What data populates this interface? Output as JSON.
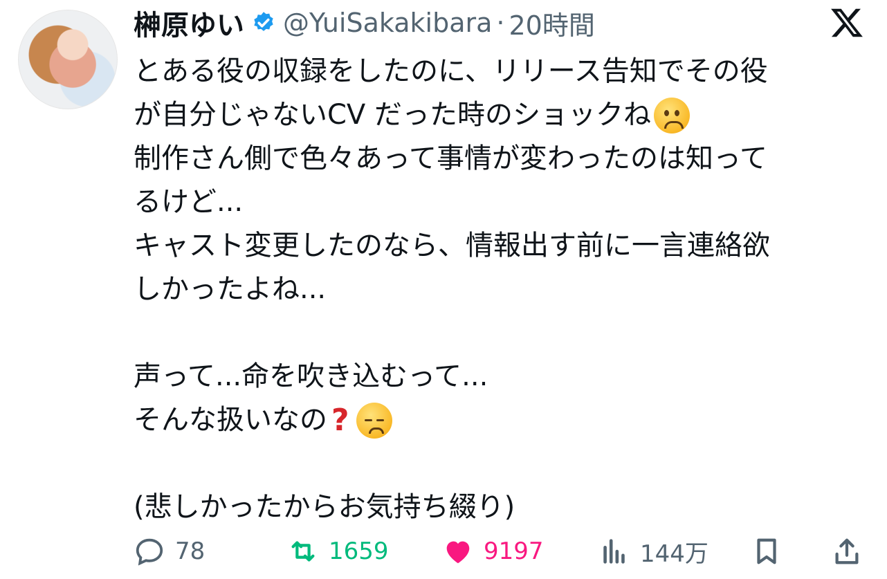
{
  "author": {
    "display_name": "榊原ゆい",
    "handle": "@YuiSakakibara",
    "separator": "·",
    "time": "20時間"
  },
  "tweet": {
    "lines": [
      "とある役の収録をしたのに、リリース告知でその役",
      "が自分じゃないCV だった時のショックね",
      "制作さん側で色々あって事情が変わったのは知って",
      "るけど...",
      "キャスト変更したのなら、情報出す前に一言連絡欲",
      "しかったよね...",
      "",
      "声って...命を吹き込むって...",
      "そんな扱いなの",
      "",
      "(悲しかったからお気持ち綴り)"
    ],
    "emoji": [
      "worried-face-emoji",
      "red-question-mark-emoji",
      "pensive-face-emoji"
    ]
  },
  "actions": {
    "reply_count": "78",
    "retweet_count": "1659",
    "like_count": "9197",
    "views_count": "144万"
  },
  "colors": {
    "text": "#0f1419",
    "secondary": "#536471",
    "verified": "#1d9bf0",
    "retweet": "#00ba7c",
    "like": "#f91880"
  }
}
